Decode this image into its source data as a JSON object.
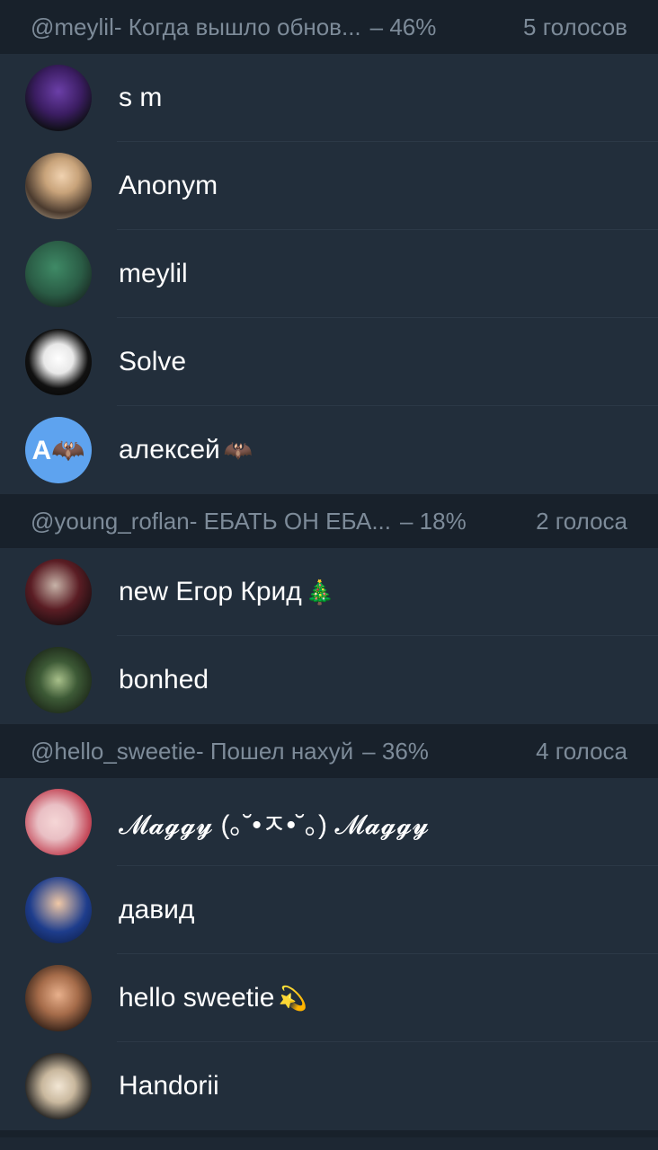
{
  "sections": [
    {
      "option": "@meylil- Когда вышло обнов...",
      "percent": "– 46%",
      "votes": "5 голосов",
      "voters": [
        {
          "name": "s m",
          "emoji": "",
          "avatar_letter": ""
        },
        {
          "name": "Anonym",
          "emoji": "",
          "avatar_letter": ""
        },
        {
          "name": "meylil",
          "emoji": "",
          "avatar_letter": ""
        },
        {
          "name": "Solve",
          "emoji": "",
          "avatar_letter": ""
        },
        {
          "name": "алексей",
          "emoji": "🦇",
          "avatar_letter": "А🦇"
        }
      ]
    },
    {
      "option": "@young_roflan- ЕБАТЬ ОН ЕБА...",
      "percent": "– 18%",
      "votes": "2 голоса",
      "voters": [
        {
          "name": "new Егор Крид",
          "emoji": "🎄",
          "avatar_letter": ""
        },
        {
          "name": "bonhed",
          "emoji": "",
          "avatar_letter": ""
        }
      ]
    },
    {
      "option": "@hello_sweetie- Пошел нахуй",
      "percent": "– 36%",
      "votes": "4 голоса",
      "voters": [
        {
          "name": "𝓜𝓪𝓰𝓰𝔂 (｡˘•ㅈ•˘｡) 𝓜𝓪𝓰𝓰𝔂",
          "emoji": "",
          "avatar_letter": ""
        },
        {
          "name": "давид",
          "emoji": "",
          "avatar_letter": ""
        },
        {
          "name": "hello sweetie",
          "emoji": "💫",
          "avatar_letter": ""
        },
        {
          "name": "Handorii",
          "emoji": "",
          "avatar_letter": ""
        }
      ]
    }
  ]
}
